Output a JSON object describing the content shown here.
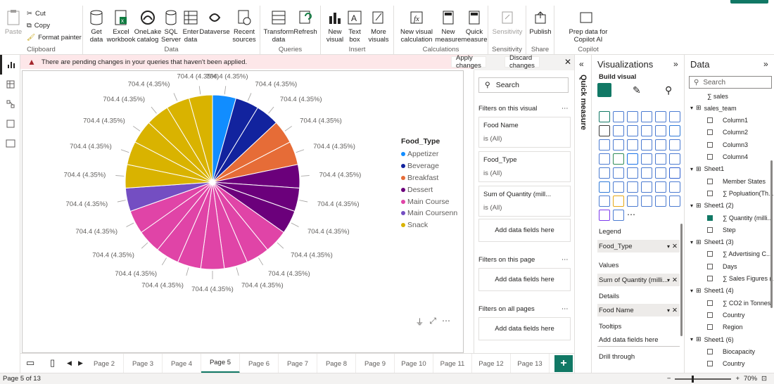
{
  "ribbon": {
    "clipboard": {
      "paste": "Paste",
      "cut": "Cut",
      "copy": "Copy",
      "format_painter": "Format painter",
      "label": "Clipboard"
    },
    "data": {
      "get_data": "Get data",
      "excel": "Excel workbook",
      "onelake": "OneLake catalog",
      "sql": "SQL Server",
      "enter": "Enter data",
      "dataverse": "Dataverse",
      "recent": "Recent sources",
      "label": "Data"
    },
    "queries": {
      "transform": "Transform data",
      "refresh": "Refresh",
      "label": "Queries"
    },
    "insert": {
      "new_visual": "New visual",
      "text_box": "Text box",
      "more_visuals": "More visuals",
      "label": "Insert"
    },
    "calculations": {
      "new_visual_calc": "New visual calculation",
      "new_measure": "New measure",
      "quick_measure": "Quick measure",
      "label": "Calculations"
    },
    "sensitivity": {
      "sensitivity": "Sensitivity",
      "label": "Sensitivity"
    },
    "share": {
      "publish": "Publish",
      "label": "Share"
    },
    "copilot": {
      "prep": "Prep data for Copilot AI",
      "label": "Copilot"
    }
  },
  "banner": {
    "message": "There are pending changes in your queries that haven't been applied.",
    "apply": "Apply changes",
    "discard": "Discard changes"
  },
  "chart_data": {
    "type": "pie",
    "legend_title": "Food_Type",
    "legend_position": "right",
    "categories": [
      "Appetizer",
      "Beverage",
      "Breakfast",
      "Dessert",
      "Main Course",
      "Main Coursenn",
      "Snack"
    ],
    "colors": [
      "#118DFF",
      "#12239E",
      "#E66C37",
      "#6B007B",
      "#E044A7",
      "#744EC2",
      "#D9B300"
    ],
    "slices": [
      {
        "category": "Appetizer",
        "count": 1
      },
      {
        "category": "Beverage",
        "count": 2
      },
      {
        "category": "Breakfast",
        "count": 2
      },
      {
        "category": "Dessert",
        "count": 3
      },
      {
        "category": "Main Course",
        "count": 8
      },
      {
        "category": "Main Coursenn",
        "count": 1
      },
      {
        "category": "Snack",
        "count": 6
      }
    ],
    "slice_value": 704.4,
    "slice_percent": "4.35%",
    "data_label": "704.4 (4.35%)"
  },
  "filters": {
    "search": "Search",
    "on_visual": "Filters on this visual",
    "cards": [
      {
        "name": "Food Name",
        "value": "is (All)"
      },
      {
        "name": "Food_Type",
        "value": "is (All)"
      },
      {
        "name": "Sum of Quantity (mill...",
        "value": "is (All)"
      }
    ],
    "add": "Add data fields here",
    "on_page": "Filters on this page",
    "on_all": "Filters on all pages",
    "quick_measure": "Quick measure"
  },
  "viz": {
    "title": "Visualizations",
    "build": "Build visual",
    "legend": "Legend",
    "legend_field": "Food_Type",
    "values": "Values",
    "values_field": "Sum of Quantity (milli...",
    "details": "Details",
    "details_field": "Food Name",
    "tooltips": "Tooltips",
    "tooltips_add": "Add data fields here",
    "drill": "Drill through"
  },
  "data_pane": {
    "title": "Data",
    "search": "Search",
    "rows": [
      {
        "text": "∑  sales",
        "level": 2,
        "cb": false
      },
      {
        "text": "sales_team",
        "level": 1,
        "table": true
      },
      {
        "text": "Column1",
        "level": 2,
        "cb": true
      },
      {
        "text": "Column2",
        "level": 2,
        "cb": true
      },
      {
        "text": "Column3",
        "level": 2,
        "cb": true
      },
      {
        "text": "Column4",
        "level": 2,
        "cb": true
      },
      {
        "text": "Sheet1",
        "level": 1,
        "table": true
      },
      {
        "text": "Member States",
        "level": 2,
        "cb": true
      },
      {
        "text": "∑  Popluation(Th...",
        "level": 2,
        "cb": true
      },
      {
        "text": "Sheet1 (2)",
        "level": 1,
        "table": true
      },
      {
        "text": "∑  Quantity (milli...",
        "level": 2,
        "cb": true,
        "checked": true
      },
      {
        "text": "Step",
        "level": 2,
        "cb": true
      },
      {
        "text": "Sheet1 (3)",
        "level": 1,
        "table": true
      },
      {
        "text": "∑  Advertising C...",
        "level": 2,
        "cb": true
      },
      {
        "text": "Days",
        "level": 2,
        "cb": true
      },
      {
        "text": "∑  Sales Figures (...",
        "level": 2,
        "cb": true
      },
      {
        "text": "Sheet1 (4)",
        "level": 1,
        "table": true
      },
      {
        "text": "∑  CO2 in Tonnes",
        "level": 2,
        "cb": true
      },
      {
        "text": "Country",
        "level": 2,
        "cb": true
      },
      {
        "text": "Region",
        "level": 2,
        "cb": true
      },
      {
        "text": "Sheet1 (6)",
        "level": 1,
        "table": true
      },
      {
        "text": "Biocapacity",
        "level": 2,
        "cb": true
      },
      {
        "text": "Country",
        "level": 2,
        "cb": true
      }
    ]
  },
  "tabs": [
    "Page 2",
    "Page 3",
    "Page 4",
    "Page 5",
    "Page 6",
    "Page 7",
    "Page 8",
    "Page 9",
    "Page 10",
    "Page 11",
    "Page 12",
    "Page 13"
  ],
  "active_tab": "Page 5",
  "status": {
    "page": "Page 5 of 13",
    "zoom": "70%"
  }
}
